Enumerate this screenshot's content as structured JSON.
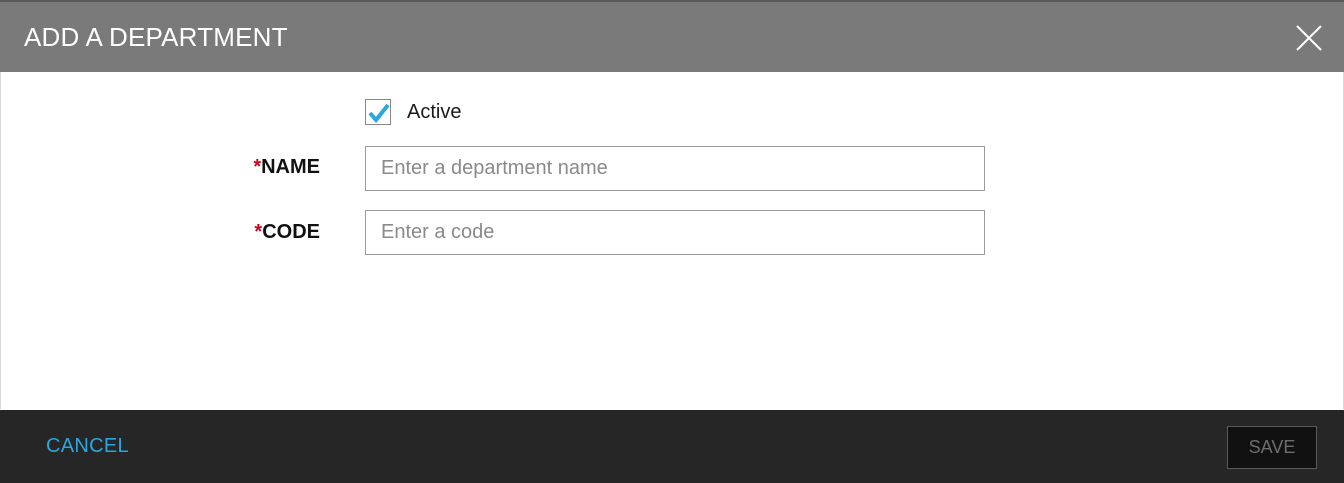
{
  "dialog": {
    "title": "ADD A DEPARTMENT",
    "close_icon": "close-icon"
  },
  "form": {
    "active": {
      "label": "Active",
      "checked": true,
      "check_color": "#2ba6de"
    },
    "name": {
      "required_mark": "*",
      "label": "NAME",
      "value": "",
      "placeholder": "Enter a department name"
    },
    "code": {
      "required_mark": "*",
      "label": "CODE",
      "value": "",
      "placeholder": "Enter a code"
    }
  },
  "footer": {
    "cancel_label": "CANCEL",
    "save_label": "SAVE",
    "save_enabled": false
  },
  "colors": {
    "header_bg": "#7a7a7a",
    "footer_bg": "#262626",
    "accent": "#2ba6de",
    "required": "#d0021b"
  }
}
